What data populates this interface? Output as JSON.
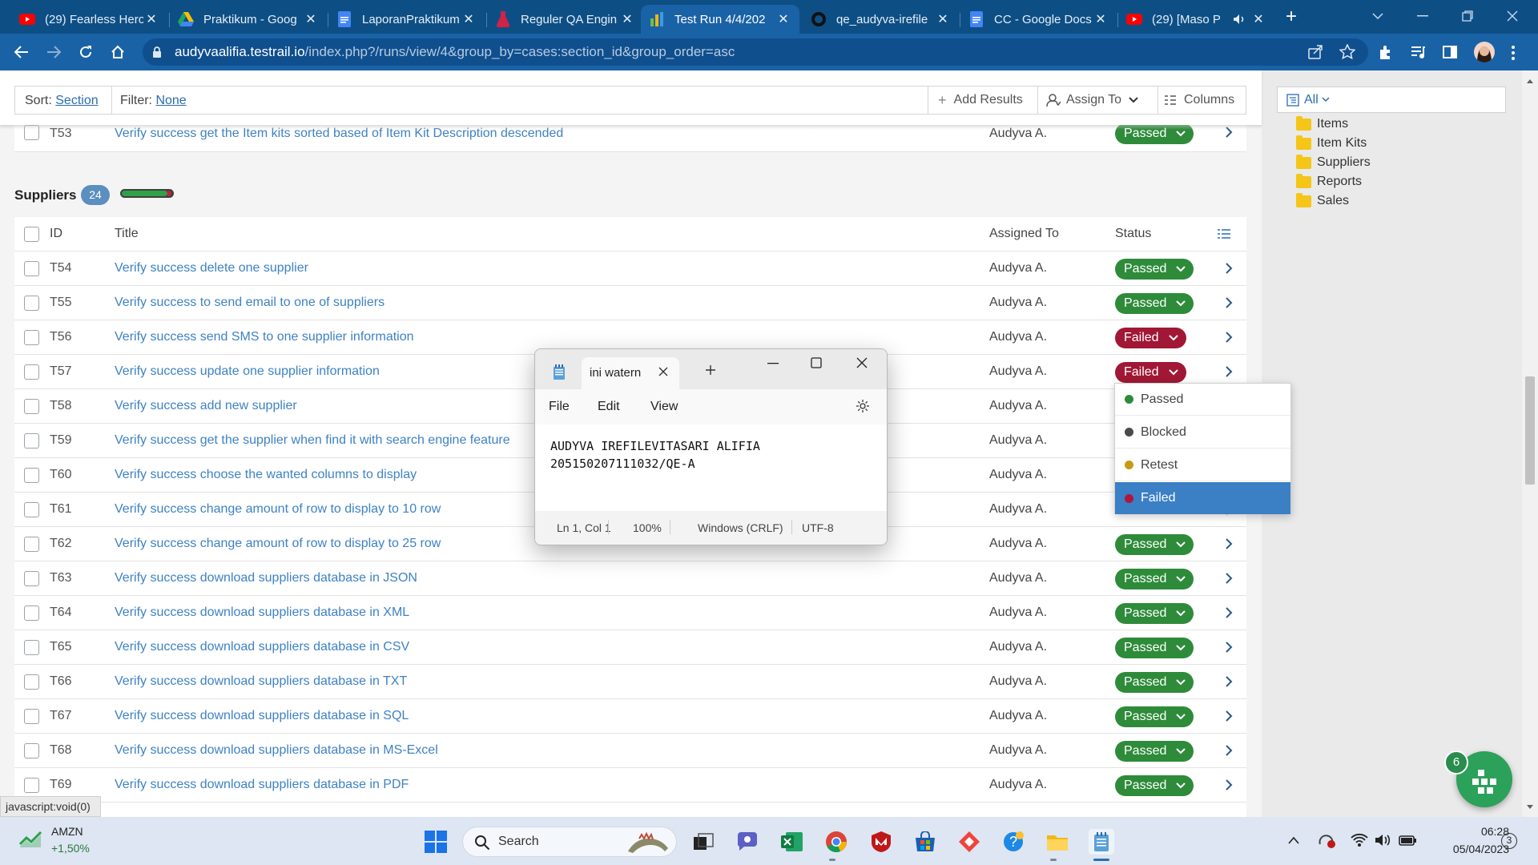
{
  "browser": {
    "tabs": [
      {
        "title": "(29) Fearless Hero",
        "icon": "youtube-icon"
      },
      {
        "title": "Praktikum - Goog",
        "icon": "google-drive-icon"
      },
      {
        "title": "LaporanPraktikum",
        "icon": "google-docs-icon"
      },
      {
        "title": "Reguler QA Engin",
        "icon": "flask-icon"
      },
      {
        "title": "Test Run 4/4/202",
        "icon": "testrail-icon",
        "active": true
      },
      {
        "title": "qe_audyva-irefile",
        "icon": "github-icon"
      },
      {
        "title": "CC - Google Docs",
        "icon": "google-docs-icon"
      },
      {
        "title": "(29) [Maso P",
        "icon": "youtube-icon"
      }
    ],
    "url_host": "audyvaalifia.testrail.io",
    "url_path": "/index.php?/runs/view/4&group_by=cases:section_id&group_order=asc"
  },
  "filterbar": {
    "sort_label": "Sort:",
    "sort_value": "Section",
    "filter_label": "Filter:",
    "filter_value": "None",
    "add_results": "Add Results",
    "assign_to": "Assign To",
    "columns": "Columns"
  },
  "previous_row": {
    "id": "T53",
    "title": "Verify success get the Item kits sorted based of Item Kit Description descended",
    "assigned": "Audyva A.",
    "status": "Passed"
  },
  "section": {
    "name": "Suppliers",
    "count": "24",
    "progress": {
      "passed_fraction": 0.9,
      "failed_fraction": 0.08
    }
  },
  "table": {
    "headers": {
      "id": "ID",
      "title": "Title",
      "assigned": "Assigned To",
      "status": "Status"
    },
    "rows": [
      {
        "id": "T54",
        "title": "Verify success delete one supplier",
        "assigned": "Audyva A.",
        "status": "Passed"
      },
      {
        "id": "T55",
        "title": "Verify success to send email to one of suppliers",
        "assigned": "Audyva A.",
        "status": "Passed"
      },
      {
        "id": "T56",
        "title": "Verify success send SMS to one supplier information",
        "assigned": "Audyva A.",
        "status": "Failed"
      },
      {
        "id": "T57",
        "title": "Verify success update one supplier information",
        "assigned": "Audyva A.",
        "status": "Failed"
      },
      {
        "id": "T58",
        "title": "Verify success add new supplier",
        "assigned": "Audyva A.",
        "status": ""
      },
      {
        "id": "T59",
        "title": "Verify success get the supplier when find it with search engine feature",
        "assigned": "Audyva A.",
        "status": ""
      },
      {
        "id": "T60",
        "title": "Verify success choose the wanted columns to display",
        "assigned": "Audyva A.",
        "status": ""
      },
      {
        "id": "T61",
        "title": "Verify success change amount of row to display to 10 row",
        "assigned": "Audyva A.",
        "status": ""
      },
      {
        "id": "T62",
        "title": "Verify success change amount of row to display to 25 row",
        "assigned": "Audyva A.",
        "status": "Passed"
      },
      {
        "id": "T63",
        "title": "Verify success download suppliers database in JSON",
        "assigned": "Audyva A.",
        "status": "Passed"
      },
      {
        "id": "T64",
        "title": "Verify success download suppliers database in XML",
        "assigned": "Audyva A.",
        "status": "Passed"
      },
      {
        "id": "T65",
        "title": "Verify success download suppliers database in CSV",
        "assigned": "Audyva A.",
        "status": "Passed"
      },
      {
        "id": "T66",
        "title": "Verify success download suppliers database in TXT",
        "assigned": "Audyva A.",
        "status": "Passed"
      },
      {
        "id": "T67",
        "title": "Verify success download suppliers database in SQL",
        "assigned": "Audyva A.",
        "status": "Passed"
      },
      {
        "id": "T68",
        "title": "Verify success download suppliers database in MS-Excel",
        "assigned": "Audyva A.",
        "status": "Passed"
      },
      {
        "id": "T69",
        "title": "Verify success download suppliers database in PDF",
        "assigned": "Audyva A.",
        "status": "Passed"
      }
    ]
  },
  "status_dropdown": {
    "options": [
      {
        "label": "Passed",
        "color": "#2e8b3a"
      },
      {
        "label": "Blocked",
        "color": "#4a4a4a"
      },
      {
        "label": "Retest",
        "color": "#c79a12"
      },
      {
        "label": "Failed",
        "color": "#b0163a",
        "selected": true
      }
    ]
  },
  "tree": {
    "filter": "All",
    "items": [
      "Items",
      "Item Kits",
      "Suppliers",
      "Reports",
      "Sales"
    ]
  },
  "notepad": {
    "tab_title": "ini watern",
    "menu": {
      "file": "File",
      "edit": "Edit",
      "view": "View"
    },
    "line1": "AUDYVA IREFILEVITASARI ALIFIA",
    "line2": "205150207111032/QE-A",
    "status": {
      "position": "Ln 1, Col 1",
      "zoom": "100%",
      "line_ending": "Windows (CRLF)",
      "encoding": "UTF-8"
    }
  },
  "fab_badge": "6",
  "status_url": "javascript:void(0)",
  "taskbar": {
    "stock_symbol": "AMZN",
    "stock_change": "+1,50%",
    "search_label": "Search",
    "time": "06:28",
    "date": "05/04/2023",
    "notification_count": "3"
  },
  "colors": {
    "chrome_tabstrip": "#0d4f85",
    "chrome_toolbar": "#1a62a6",
    "passed": "#2e8b3a",
    "failed": "#a01835",
    "link": "#3e82c4"
  }
}
